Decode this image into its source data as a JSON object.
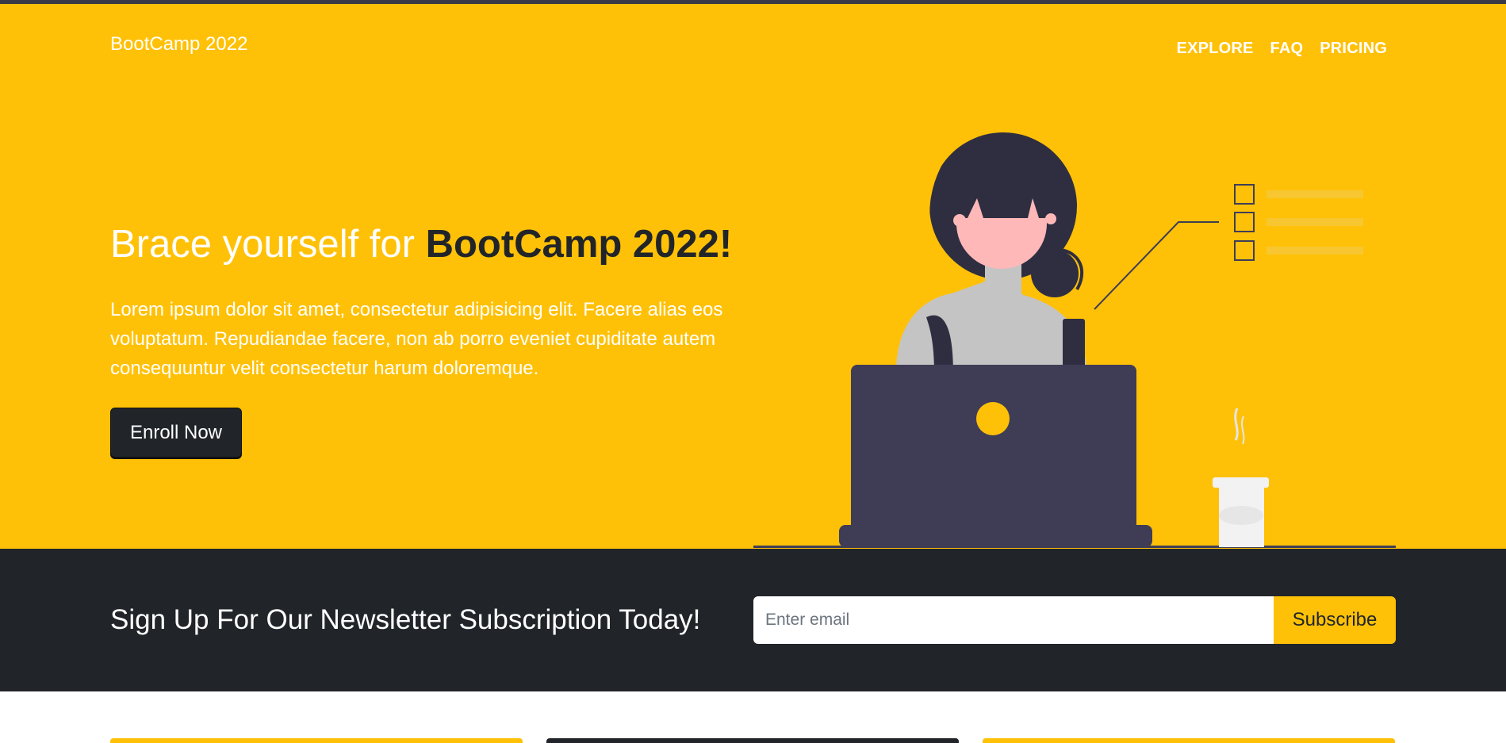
{
  "brand": "BootCamp 2022",
  "nav": {
    "explore": "EXPLORE",
    "faq": "FAQ",
    "pricing": "PRICING"
  },
  "hero": {
    "title_plain": "Brace yourself for ",
    "title_accent": "BootCamp 2022!",
    "text": "Lorem ipsum dolor sit amet, consectetur adipisicing elit. Facere alias eos voluptatum. Repudiandae facere, non ab porro eveniet cupiditate autem consequuntur velit consectetur harum doloremque.",
    "button": "Enroll Now"
  },
  "newsletter": {
    "title": "Sign Up For Our Newsletter Subscription Today!",
    "email_placeholder": "Enter email",
    "button": "Subscribe"
  },
  "colors": {
    "accent": "#ffc107",
    "dark": "#212529",
    "white": "#ffffff",
    "laptop": "#3f3d56",
    "skin": "#ffb8b8"
  },
  "icons": [
    "checkbox-icon",
    "coffee-cup-icon",
    "laptop-icon"
  ]
}
